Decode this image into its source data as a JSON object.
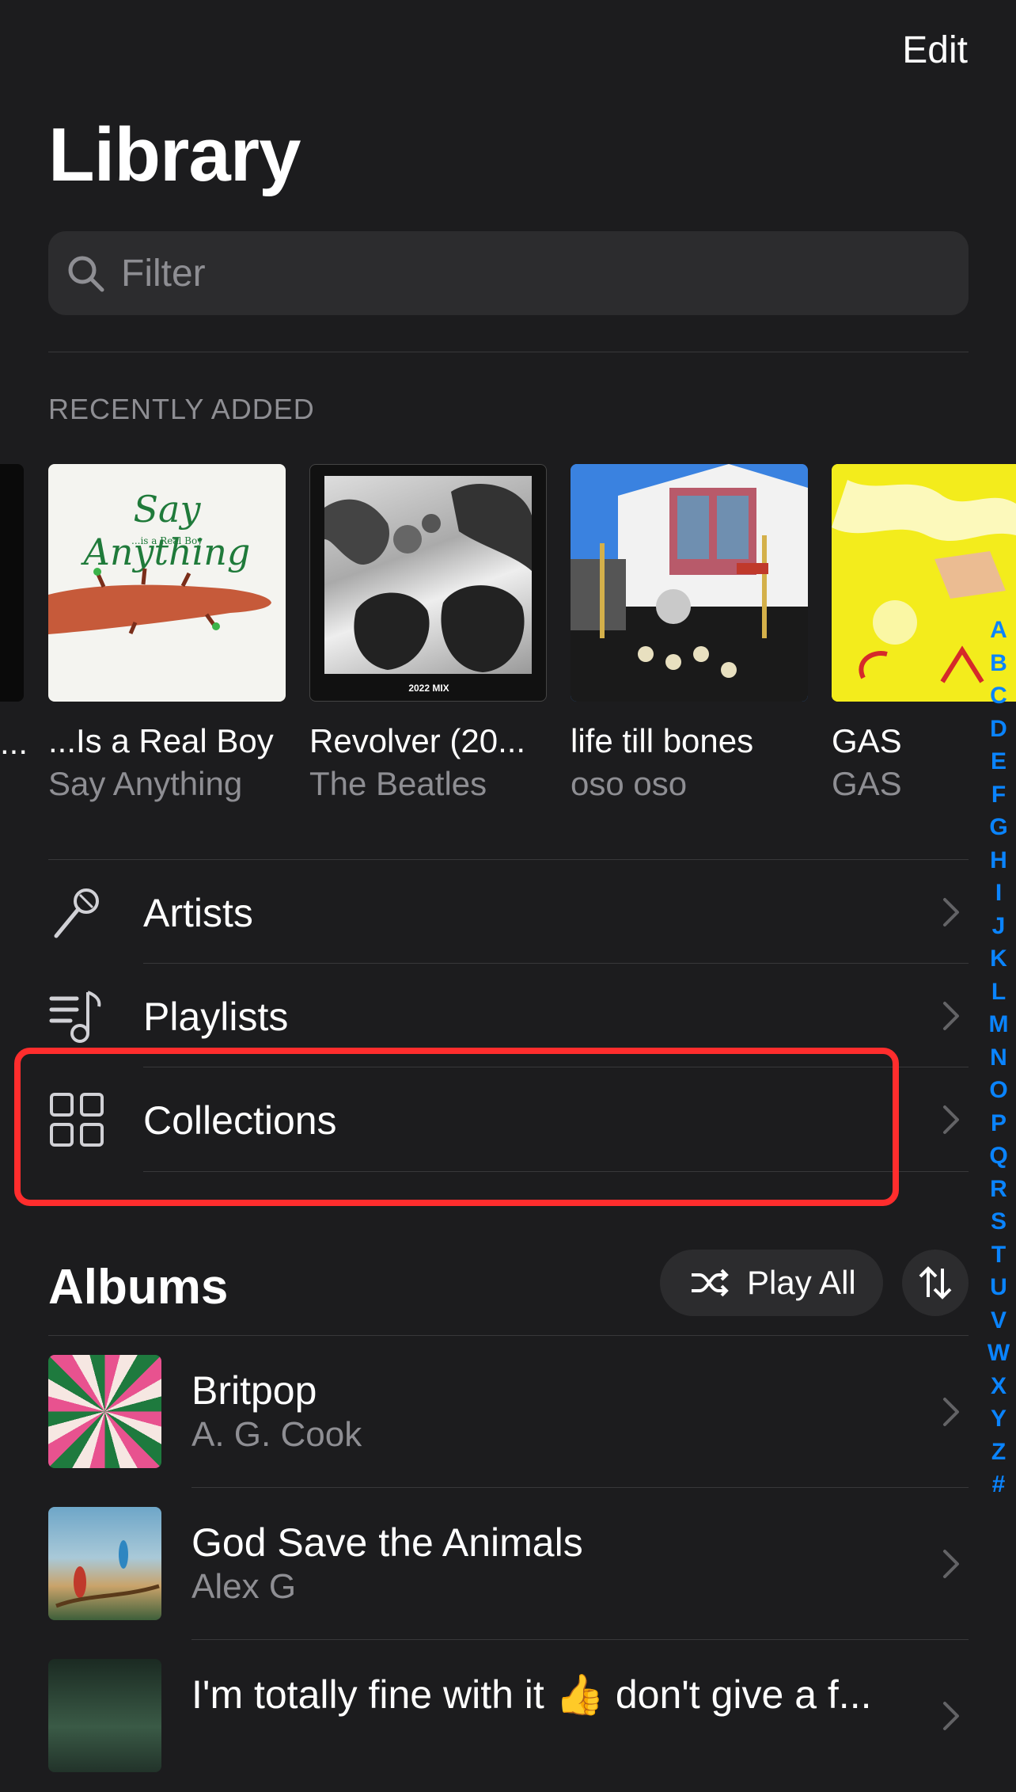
{
  "header": {
    "edit_label": "Edit",
    "title": "Library"
  },
  "search": {
    "placeholder": "Filter",
    "value": ""
  },
  "recently_added": {
    "label": "RECENTLY ADDED",
    "partial_title": "...",
    "items": [
      {
        "title": "...Is a Real Boy",
        "artist": "Say Anything",
        "cover_text": "Say Anything",
        "cover_subtext": "...is a Real Boy"
      },
      {
        "title": "Revolver (20...",
        "artist": "The Beatles",
        "cover_text": "2022 MIX"
      },
      {
        "title": "life till bones",
        "artist": "oso oso"
      },
      {
        "title": "GAS",
        "artist": "GAS"
      }
    ]
  },
  "nav": {
    "artists_label": "Artists",
    "playlists_label": "Playlists",
    "collections_label": "Collections"
  },
  "albums": {
    "title": "Albums",
    "play_all_label": "Play All",
    "items": [
      {
        "title": "Britpop",
        "artist": "A. G. Cook"
      },
      {
        "title": "God Save the Animals",
        "artist": "Alex G"
      },
      {
        "title": "I'm totally fine with it 👍 don't give a f...",
        "artist": ""
      }
    ]
  },
  "index_letters": [
    "A",
    "B",
    "C",
    "D",
    "E",
    "F",
    "G",
    "H",
    "I",
    "J",
    "K",
    "L",
    "M",
    "N",
    "O",
    "P",
    "Q",
    "R",
    "S",
    "T",
    "U",
    "V",
    "W",
    "X",
    "Y",
    "Z",
    "#"
  ],
  "colors": {
    "background": "#1c1c1e",
    "accent": "#0a84ff",
    "highlight": "#ff2d2d",
    "secondary_text": "#8e8e93"
  }
}
